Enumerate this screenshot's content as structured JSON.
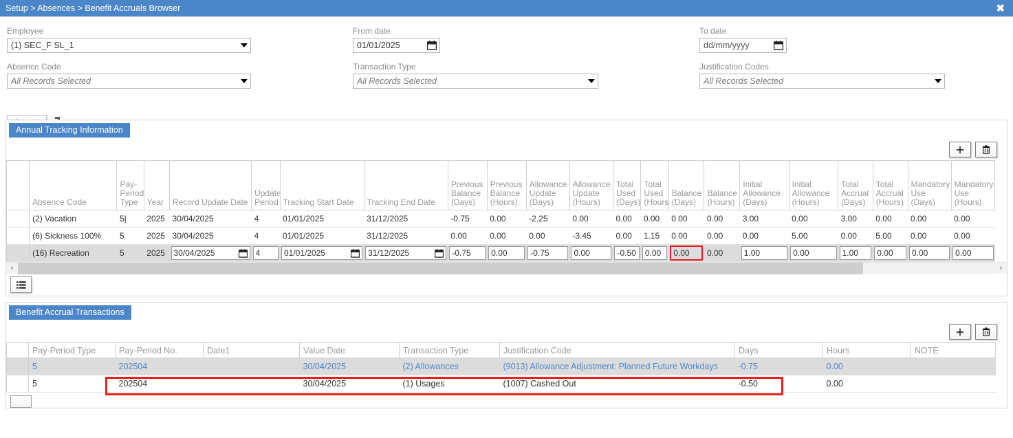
{
  "titlebar": {
    "breadcrumb": "Setup > Absences > Benefit Accruals Browser",
    "close_label": "✖"
  },
  "filters": {
    "employee": {
      "label": "Employee",
      "value": "(1) SEC_F SL_1"
    },
    "from_date": {
      "label": "From date",
      "value": "01/01/2025"
    },
    "to_date": {
      "label": "To date",
      "value": "dd/mm/yyyy"
    },
    "absence_code": {
      "label": "Absence Code",
      "value": "All Records Selected"
    },
    "transaction_type": {
      "label": "Transaction Type",
      "value": "All Records Selected"
    },
    "justification_codes": {
      "label": "Justification Codes",
      "value": "All Records Selected"
    },
    "search_button": "Search"
  },
  "annual_tracking": {
    "tab_label": "Annual Tracking Information",
    "columns": [
      "",
      "Absence Code",
      "Pay-Period Type",
      "Year",
      "Record Update Date",
      "Update Period",
      "Tracking Start Date",
      "Tracking End Date",
      "Previous Balance (Days)",
      "Previous Balance (Hours)",
      "Allowance Update (Days)",
      "Allowance Update (Hours)",
      "Total Used (Days)",
      "Total Used (Hours)",
      "Balance (Days)",
      "Balance (Hours)",
      "Initial Allowance (Days)",
      "Initial Allowance (Hours)",
      "Total Accrual (Days)",
      "Total Accrual (Hours)",
      "Mandatory Use (Days)",
      "Mandatory Use (Hours)"
    ],
    "rows": [
      {
        "selected": false,
        "cells": [
          "",
          "(2) Vacation",
          "5|",
          "2025",
          "30/04/2025",
          "4",
          "01/01/2025",
          "31/12/2025",
          "-0.75",
          "0.00",
          "-2.25",
          "0.00",
          "0.00",
          "0.00",
          "0.00",
          "0.00",
          "3.00",
          "0.00",
          "3.00",
          "0.00",
          "0.00",
          "0.00"
        ]
      },
      {
        "selected": false,
        "cells": [
          "",
          "(6) Sickness 100%",
          "5",
          "2025",
          "30/04/2025",
          "4",
          "01/01/2025",
          "31/12/2025",
          "0.00",
          "0.00",
          "0.00",
          "-3.45",
          "0.00",
          "1.15",
          "0.00",
          "0.00",
          "0.00",
          "5.00",
          "0.00",
          "5.00",
          "0.00",
          "0.00"
        ]
      },
      {
        "selected": true,
        "cells": [
          "",
          "(16) Recreation",
          "5",
          "2025",
          "30/04/2025",
          "4",
          "01/01/2025",
          "31/12/2025",
          "-0.75",
          "0.00",
          "-0.75",
          "0.00",
          "-0.50",
          "0.00",
          "0.00",
          "0.00",
          "1.00",
          "0.00",
          "1.00",
          "0.00",
          "0.00",
          "0.00"
        ]
      }
    ],
    "add_button": "+",
    "delete_button": "delete",
    "highlight_column": "Balance (Days)"
  },
  "benefit_transactions": {
    "tab_label": "Benefit Accrual Transactions",
    "columns": [
      "",
      "Pay-Period Type",
      "Pay-Period No.",
      "Date1",
      "Value Date",
      "Transaction Type",
      "Justification Code",
      "Days",
      "Hours",
      "NOTE"
    ],
    "rows": [
      {
        "selected": true,
        "cells": [
          "",
          "5",
          "202504",
          "",
          "30/04/2025",
          "(2) Allowances",
          "(9013) Allowance Adjustment: Planned Future Workdays",
          "-0.75",
          "0.00",
          ""
        ]
      },
      {
        "selected": false,
        "cells": [
          "",
          "5",
          "202504",
          "",
          "30/04/2025",
          "(1) Usages",
          "(1007) Cashed Out",
          "-0.50",
          "0.00",
          ""
        ]
      }
    ],
    "add_button": "+",
    "delete_button": "delete"
  },
  "colors": {
    "accent": "#4a86c8",
    "highlight": "#ee1c1c",
    "selected_row": "#dcdcdc",
    "link": "#4a86c8"
  },
  "scrollbar": {
    "left_arrow": "‹",
    "right_arrow": "›"
  }
}
